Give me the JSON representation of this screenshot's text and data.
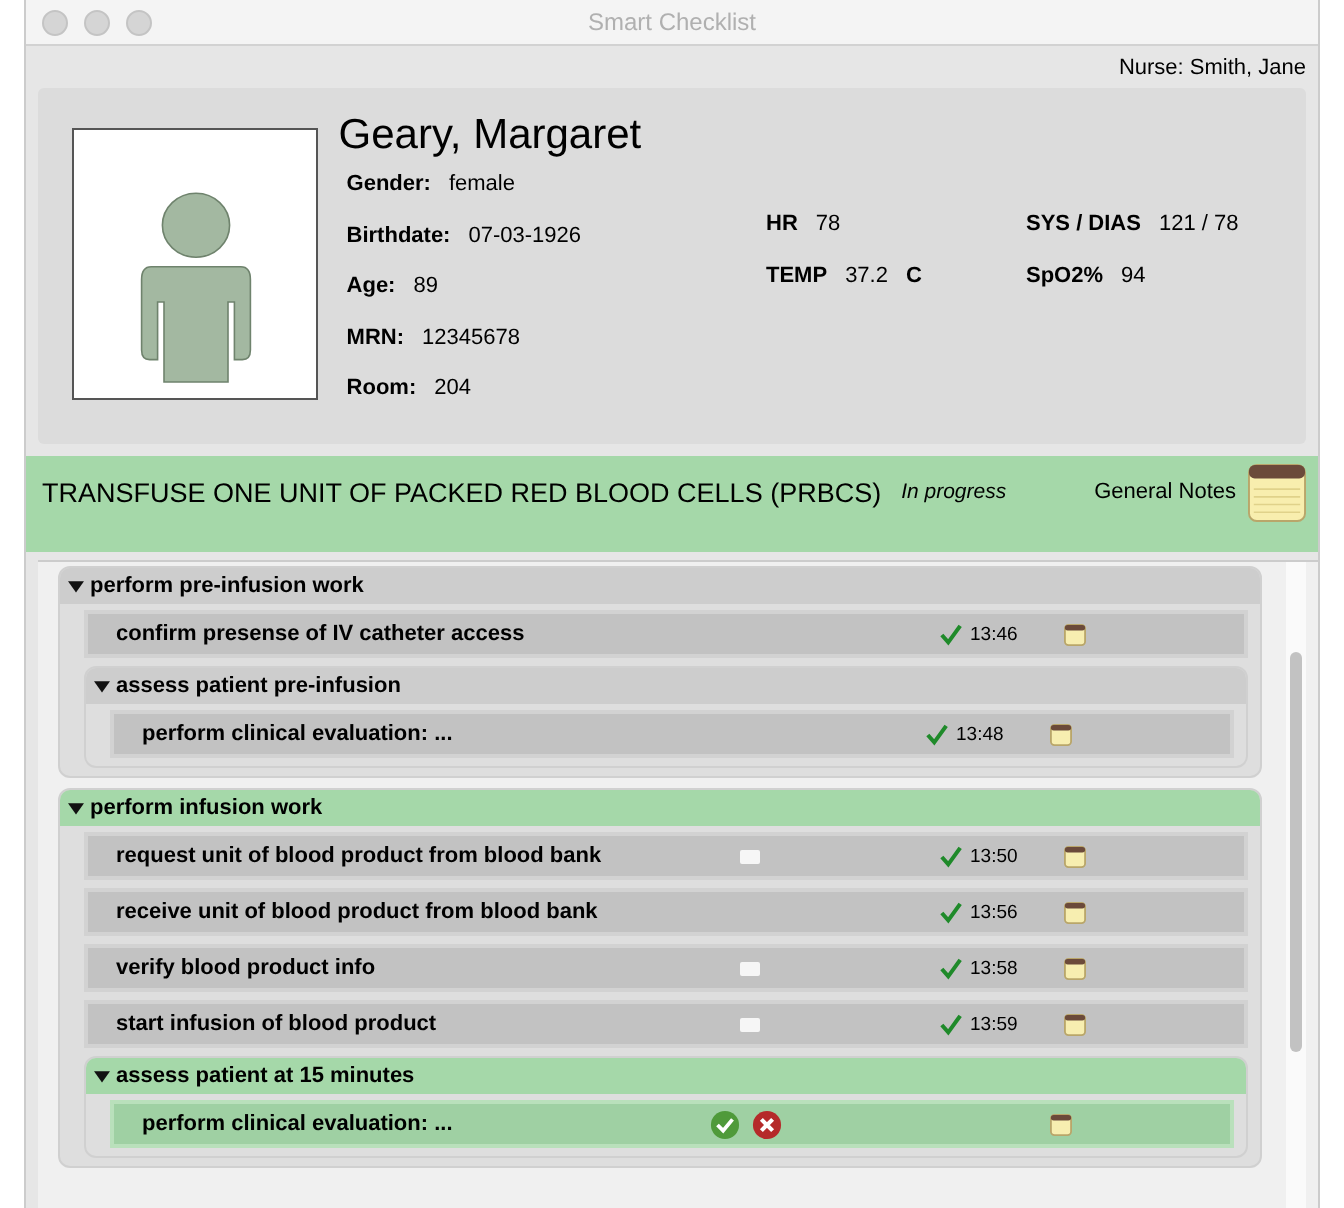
{
  "window": {
    "title": "Smart Checklist"
  },
  "nurse": "Nurse: Smith, Jane",
  "patient": {
    "name": "Geary, Margaret",
    "fields": [
      {
        "label": "Gender:",
        "value": "female"
      },
      {
        "label": "Birthdate:",
        "value": "07-03-1926"
      },
      {
        "label": "Age:",
        "value": "89"
      },
      {
        "label": "MRN:",
        "value": "12345678"
      },
      {
        "label": "Room:",
        "value": "204"
      }
    ],
    "vitals": [
      {
        "label": "HR",
        "value": "78"
      },
      {
        "label": "SYS / DIAS",
        "value": "121  /  78"
      },
      {
        "label": "TEMP",
        "value": "37.2",
        "unit": "C"
      },
      {
        "label": "SpO2%",
        "value": "94"
      }
    ]
  },
  "task": {
    "title": "TRANSFUSE ONE UNIT OF PACKED RED BLOOD CELLS (PRBCS)",
    "status": "In progress",
    "notes_label": "General Notes"
  },
  "checklist": [
    {
      "kind": "group",
      "label": "perform pre-infusion work",
      "active": false,
      "expanded": true,
      "children": [
        {
          "kind": "step",
          "label": "confirm presense of IV catheter access",
          "comment": false,
          "done": true,
          "time": "13:46",
          "active": false
        },
        {
          "kind": "group",
          "label": "assess patient pre-infusion",
          "active": false,
          "expanded": true,
          "children": [
            {
              "kind": "step",
              "label": "perform clinical evaluation: ...",
              "comment": false,
              "done": true,
              "time": "13:48",
              "active": false
            }
          ]
        }
      ]
    },
    {
      "kind": "group",
      "label": "perform infusion work",
      "active": true,
      "expanded": true,
      "children": [
        {
          "kind": "step",
          "label": "request unit of blood product from blood bank",
          "comment": true,
          "done": true,
          "time": "13:50",
          "active": false
        },
        {
          "kind": "step",
          "label": "receive unit of blood product from blood bank",
          "comment": false,
          "done": true,
          "time": "13:56",
          "active": false
        },
        {
          "kind": "step",
          "label": "verify blood product info",
          "comment": true,
          "done": true,
          "time": "13:58",
          "active": false
        },
        {
          "kind": "step",
          "label": "start infusion of blood product",
          "comment": true,
          "done": true,
          "time": "13:59",
          "active": false
        },
        {
          "kind": "group",
          "label": "assess patient at 15 minutes",
          "active": true,
          "expanded": true,
          "children": [
            {
              "kind": "step",
              "label": "perform clinical evaluation: ...",
              "comment": false,
              "done": false,
              "active": true
            }
          ]
        }
      ]
    }
  ]
}
